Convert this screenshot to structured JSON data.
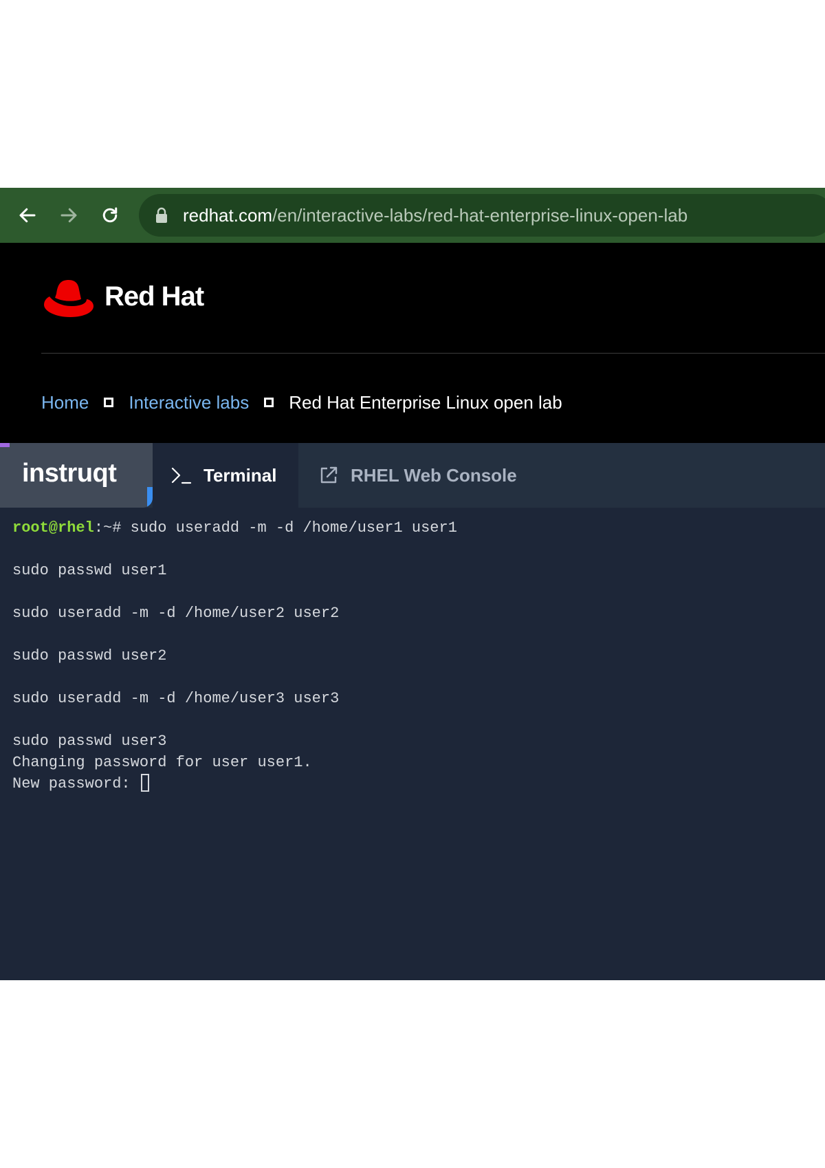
{
  "browser": {
    "url_host": "redhat.com",
    "url_path": "/en/interactive-labs/red-hat-enterprise-linux-open-lab",
    "icons": {
      "back": "arrow-left-icon",
      "forward": "arrow-right-icon",
      "reload": "reload-icon",
      "lock": "lock-icon"
    }
  },
  "header": {
    "brand": "Red Hat",
    "breadcrumb": {
      "home": "Home",
      "labs": "Interactive labs",
      "current": "Red Hat Enterprise Linux open lab"
    }
  },
  "tabs": {
    "logo": "instruqt",
    "terminal": "Terminal",
    "console": "RHEL Web Console"
  },
  "terminal": {
    "prompt_user": "root@rhel",
    "prompt_rest": ":~#",
    "command": " sudo useradd -m -d /home/user1 user1",
    "lines": [
      "sudo passwd user1",
      "sudo useradd -m -d /home/user2 user2",
      "sudo passwd user2",
      "sudo useradd -m -d /home/user3 user3",
      "sudo passwd user3",
      "Changing password for user user1.",
      "New password: "
    ]
  },
  "colors": {
    "browser_bar": "#2d5a2d",
    "prompt_user": "#8fdc3a",
    "terminal_bg": "#1d2638",
    "link": "#7ab6ef",
    "redhat_red": "#ee0000"
  }
}
